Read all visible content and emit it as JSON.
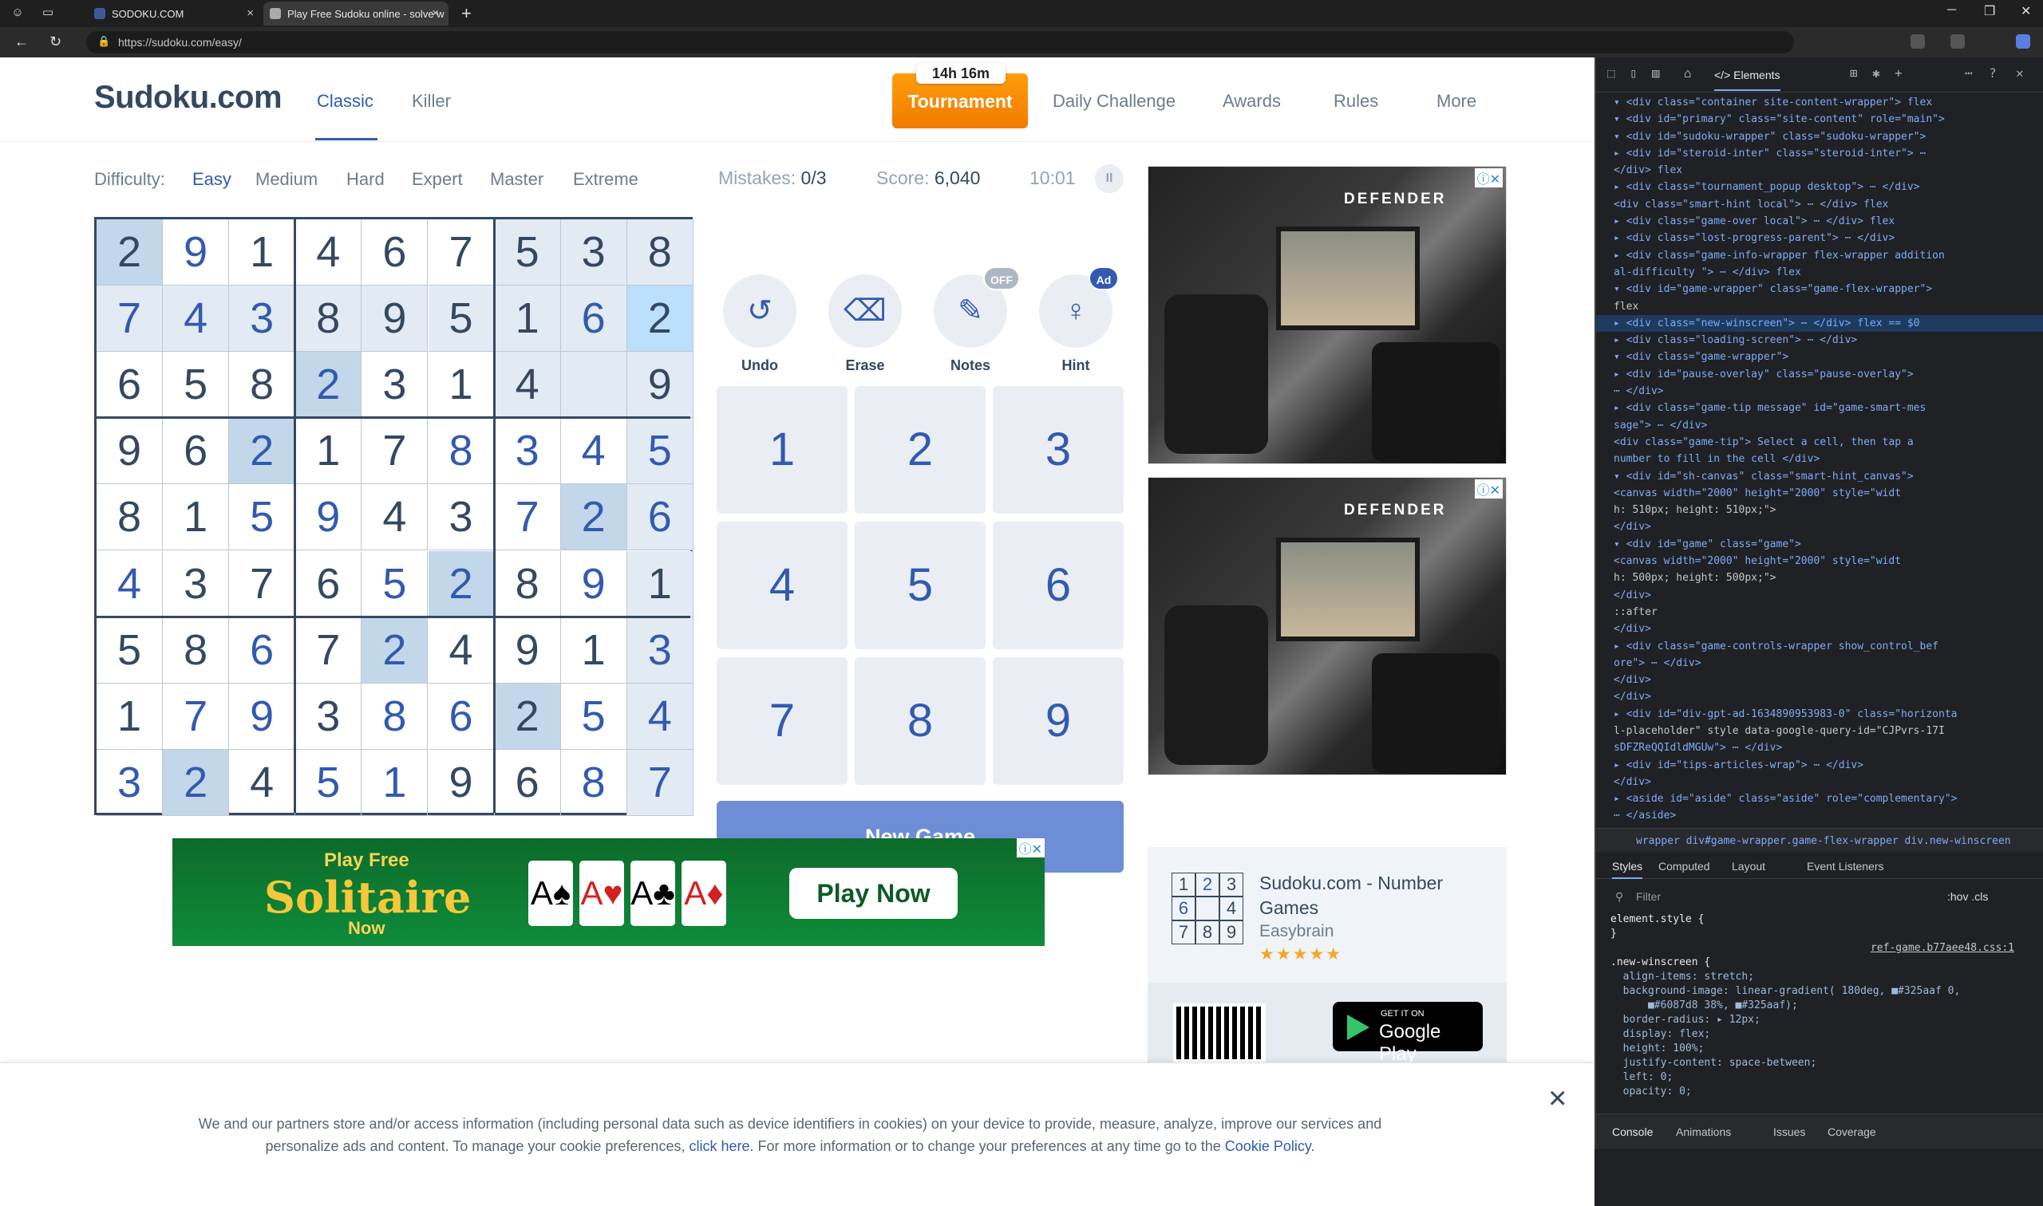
{
  "browser": {
    "tabs": [
      {
        "label": "SODOKU.COM",
        "close": "×"
      },
      {
        "label": "Play Free Sudoku online - solve w",
        "close": "×"
      }
    ],
    "new_tab": "+",
    "url": "https://sudoku.com/easy/"
  },
  "site": {
    "logo": "Sudoku.com",
    "nav": [
      "Classic",
      "Killer"
    ],
    "tournament": {
      "label": "Tournament",
      "badge": "14h 16m"
    },
    "right_nav": [
      "Daily Challenge",
      "Awards",
      "Rules",
      "More"
    ]
  },
  "difficulty": {
    "label": "Difficulty:",
    "levels": [
      "Easy",
      "Medium",
      "Hard",
      "Expert",
      "Master",
      "Extreme"
    ],
    "selected": "Easy"
  },
  "stats": {
    "mistakes_label": "Mistakes:",
    "mistakes": "0/3",
    "score_label": "Score:",
    "score": "6,040",
    "timer": "10:01"
  },
  "board": [
    [
      "2",
      "9",
      "1",
      "4",
      "6",
      "7",
      "5",
      "3",
      "8"
    ],
    [
      "7",
      "4",
      "3",
      "8",
      "9",
      "5",
      "1",
      "6",
      "2"
    ],
    [
      "6",
      "5",
      "8",
      "2",
      "3",
      "1",
      "4",
      "",
      "9"
    ],
    [
      "9",
      "6",
      "2",
      "1",
      "7",
      "8",
      "3",
      "4",
      "5"
    ],
    [
      "8",
      "1",
      "5",
      "9",
      "4",
      "3",
      "7",
      "2",
      "6"
    ],
    [
      "4",
      "3",
      "7",
      "6",
      "5",
      "2",
      "8",
      "9",
      "1"
    ],
    [
      "5",
      "8",
      "6",
      "7",
      "2",
      "4",
      "9",
      "1",
      "3"
    ],
    [
      "1",
      "7",
      "9",
      "3",
      "8",
      "6",
      "2",
      "5",
      "4"
    ],
    [
      "3",
      "2",
      "4",
      "5",
      "1",
      "9",
      "6",
      "8",
      "7"
    ]
  ],
  "controls": [
    {
      "label": "Undo",
      "icon": "undo-icon"
    },
    {
      "label": "Erase",
      "icon": "eraser-icon"
    },
    {
      "label": "Notes",
      "icon": "pencil-icon",
      "badge": "OFF"
    },
    {
      "label": "Hint",
      "icon": "lightbulb-icon",
      "badge": "Ad"
    }
  ],
  "numpad": [
    "1",
    "2",
    "3",
    "4",
    "5",
    "6",
    "7",
    "8",
    "9"
  ],
  "new_game": "New Game",
  "ads": {
    "defender_brand": "DEFENDER",
    "solitaire": {
      "top": "Play Free",
      "title": "Solitaire",
      "bottom": "Now",
      "cta": "Play Now",
      "cards": [
        "A♠",
        "A♥",
        "A♣",
        "A♦"
      ]
    }
  },
  "app_card": {
    "icon_digits": [
      "1",
      "2",
      "3",
      "6",
      "",
      "4",
      "7",
      "8",
      "9"
    ],
    "name": "Sudoku.com - Number Games",
    "developer": "Easybrain",
    "stars": "★★★★★",
    "gplay_small": "GET IT ON",
    "gplay_big": "Google Play"
  },
  "cookie": {
    "text_1": "We and our partners store and/or access information (including personal data such as device identifiers in cookies) on your device to provide, measure, analyze, improve our services and personalize ads and content. To manage your cookie preferences, ",
    "link_1": "click here",
    "text_2": ". For more information or to change your preferences at any time go to the ",
    "link_2": "Cookie Policy",
    "text_3": ".",
    "close": "×"
  },
  "devtools": {
    "tabs": [
      "Elements"
    ],
    "dom_lines": [
      "▾ <div class=\"container site-content-wrapper\"> flex",
      "  ▾ <div id=\"primary\" class=\"site-content\" role=\"main\">",
      "    ▾ <div id=\"sudoku-wrapper\" class=\"sudoku-wrapper\">",
      "      ▸ <div id=\"steroid-inter\" class=\"steroid-inter\"> ⋯",
      "        </div> flex",
      "      ▸ <div class=\"tournament_popup desktop\"> ⋯ </div>",
      "        <div class=\"smart-hint local\"> ⋯ </div> flex",
      "      ▸ <div class=\"game-over local\"> ⋯ </div> flex",
      "      ▸ <div class=\"lost-progress-parent\"> ⋯ </div>",
      "      ▸ <div class=\"game-info-wrapper flex-wrapper addition",
      "        al-difficulty \"> ⋯ </div> flex",
      "      ▾ <div id=\"game-wrapper\" class=\"game-flex-wrapper\">",
      "        flex",
      "        ▸ <div class=\"new-winscreen\"> ⋯ </div> flex == $0",
      "        ▸ <div class=\"loading-screen\"> ⋯ </div>",
      "        ▾ <div class=\"game-wrapper\">",
      "          ▸ <div id=\"pause-overlay\" class=\"pause-overlay\">",
      "            ⋯ </div>",
      "          ▸ <div class=\"game-tip message\" id=\"game-smart-mes",
      "            sage\"> ⋯ </div>",
      "            <div class=\"game-tip\"> Select a cell, then tap a",
      "            number to fill in the cell </div>",
      "          ▾ <div id=\"sh-canvas\" class=\"smart-hint_canvas\">",
      "              <canvas width=\"2000\" height=\"2000\" style=\"widt",
      "              h: 510px; height: 510px;\">",
      "            </div>",
      "          ▾ <div id=\"game\" class=\"game\">",
      "              <canvas width=\"2000\" height=\"2000\" style=\"widt",
      "              h: 500px; height: 500px;\">",
      "            </div>",
      "            ::after",
      "          </div>",
      "        ▸ <div class=\"game-controls-wrapper show_control_bef",
      "          ore\"> ⋯ </div>",
      "        </div>",
      "      </div>",
      "    ▸ <div id=\"div-gpt-ad-1634890953983-0\" class=\"horizonta",
      "      l-placeholder\" style data-google-query-id=\"CJPvrs-17I",
      "      sDFZReQQIdldMGUw\"> ⋯ </div>",
      "    ▸ <div id=\"tips-articles-wrap\"> ⋯ </div>",
      "    </div>",
      "  ▸ <aside id=\"aside\" class=\"aside\" role=\"complementary\">",
      "    ⋯ </aside>"
    ],
    "breadcrumbs": "wrapper   div#game-wrapper.game-flex-wrapper   div.new-winscreen",
    "style_tabs": [
      "Styles",
      "Computed",
      "Layout",
      "Event Listeners"
    ],
    "filter_placeholder": "Filter",
    "filter_right": ":hov  .cls",
    "style_lines": [
      "element.style {",
      "}",
      ".new-winscreen {",
      "  align-items: stretch;",
      "  background-image: linear-gradient( 180deg, ■#325aaf 0,",
      "      ■#6087d8 38%, ■#325aaf);",
      "  border-radius: ▸ 12px;",
      "  display: flex;",
      "  height: 100%;",
      "  justify-content: space-between;",
      "  left: 0;",
      "  opacity: 0;"
    ],
    "style_source": "ref-game.b77aee48.css:1",
    "drawer_tabs": [
      "Console",
      "Animations",
      "Issues",
      "Coverage"
    ]
  }
}
